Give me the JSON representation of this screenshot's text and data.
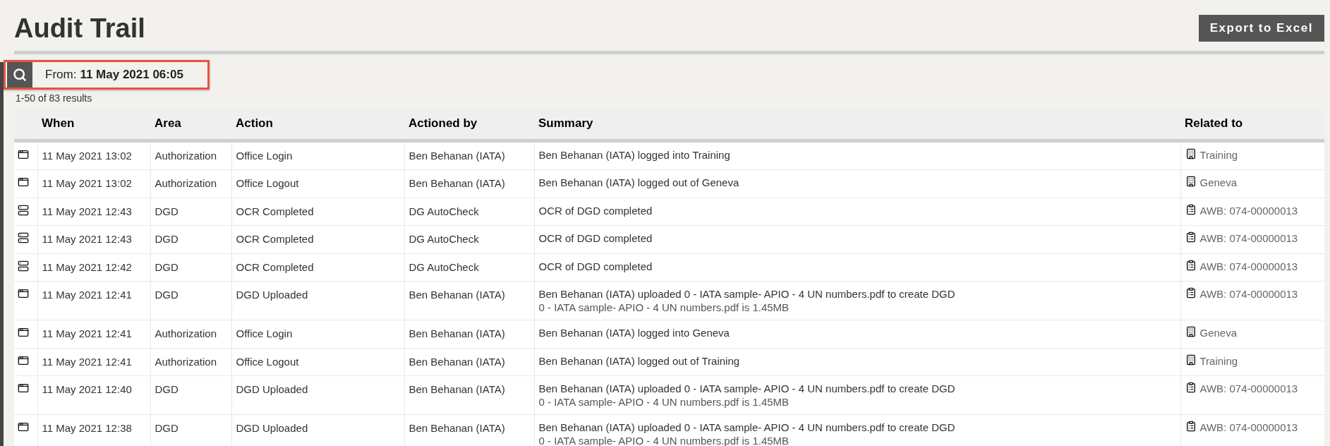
{
  "title": "Audit Trail",
  "export_button": "Export to Excel",
  "filter": {
    "label": "From:",
    "value": "11 May 2021 06:05"
  },
  "results_count": "1-50 of 83 results",
  "table": {
    "columns": [
      "When",
      "Area",
      "Action",
      "Actioned by",
      "Summary",
      "Related to"
    ],
    "rows": [
      {
        "kind": "window",
        "when": "11 May 2021 13:02",
        "area": "Authorization",
        "action": "Office Login",
        "actioned_by": "Ben Behanan (IATA)",
        "summary": [
          "Ben Behanan (IATA) logged into Training"
        ],
        "related": {
          "kind": "office",
          "text": "Training"
        }
      },
      {
        "kind": "window",
        "when": "11 May 2021 13:02",
        "area": "Authorization",
        "action": "Office Logout",
        "actioned_by": "Ben Behanan (IATA)",
        "summary": [
          "Ben Behanan (IATA) logged out of Geneva"
        ],
        "related": {
          "kind": "office",
          "text": "Geneva"
        }
      },
      {
        "kind": "server",
        "when": "11 May 2021 12:43",
        "area": "DGD",
        "action": "OCR Completed",
        "actioned_by": "DG AutoCheck",
        "summary": [
          "OCR of DGD completed"
        ],
        "related": {
          "kind": "awb",
          "text": "AWB: 074-00000013"
        }
      },
      {
        "kind": "server",
        "when": "11 May 2021 12:43",
        "area": "DGD",
        "action": "OCR Completed",
        "actioned_by": "DG AutoCheck",
        "summary": [
          "OCR of DGD completed"
        ],
        "related": {
          "kind": "awb",
          "text": "AWB: 074-00000013"
        }
      },
      {
        "kind": "server",
        "when": "11 May 2021 12:42",
        "area": "DGD",
        "action": "OCR Completed",
        "actioned_by": "DG AutoCheck",
        "summary": [
          "OCR of DGD completed"
        ],
        "related": {
          "kind": "awb",
          "text": "AWB: 074-00000013"
        }
      },
      {
        "kind": "window",
        "when": "11 May 2021 12:41",
        "area": "DGD",
        "action": "DGD Uploaded",
        "actioned_by": "Ben Behanan (IATA)",
        "summary": [
          "Ben Behanan (IATA) uploaded 0 - IATA sample- APIO - 4 UN numbers.pdf to create DGD",
          "0 - IATA sample- APIO - 4 UN numbers.pdf is 1.45MB"
        ],
        "related": {
          "kind": "awb",
          "text": "AWB: 074-00000013"
        }
      },
      {
        "kind": "window",
        "when": "11 May 2021 12:41",
        "area": "Authorization",
        "action": "Office Login",
        "actioned_by": "Ben Behanan (IATA)",
        "summary": [
          "Ben Behanan (IATA) logged into Geneva"
        ],
        "related": {
          "kind": "office",
          "text": "Geneva"
        }
      },
      {
        "kind": "window",
        "when": "11 May 2021 12:41",
        "area": "Authorization",
        "action": "Office Logout",
        "actioned_by": "Ben Behanan (IATA)",
        "summary": [
          "Ben Behanan (IATA) logged out of Training"
        ],
        "related": {
          "kind": "office",
          "text": "Training"
        }
      },
      {
        "kind": "window",
        "when": "11 May 2021 12:40",
        "area": "DGD",
        "action": "DGD Uploaded",
        "actioned_by": "Ben Behanan (IATA)",
        "summary": [
          "Ben Behanan (IATA) uploaded 0 - IATA sample- APIO - 4 UN numbers.pdf to create DGD",
          "0 - IATA sample- APIO - 4 UN numbers.pdf is 1.45MB"
        ],
        "related": {
          "kind": "awb",
          "text": "AWB: 074-00000013"
        }
      },
      {
        "kind": "window",
        "when": "11 May 2021 12:38",
        "area": "DGD",
        "action": "DGD Uploaded",
        "actioned_by": "Ben Behanan (IATA)",
        "summary": [
          "Ben Behanan (IATA) uploaded 0 - IATA sample- APIO - 4 UN numbers.pdf to create DGD",
          "0 - IATA sample- APIO - 4 UN numbers.pdf is 1.45MB"
        ],
        "related": {
          "kind": "awb",
          "text": "AWB: 074-00000013"
        }
      }
    ]
  }
}
